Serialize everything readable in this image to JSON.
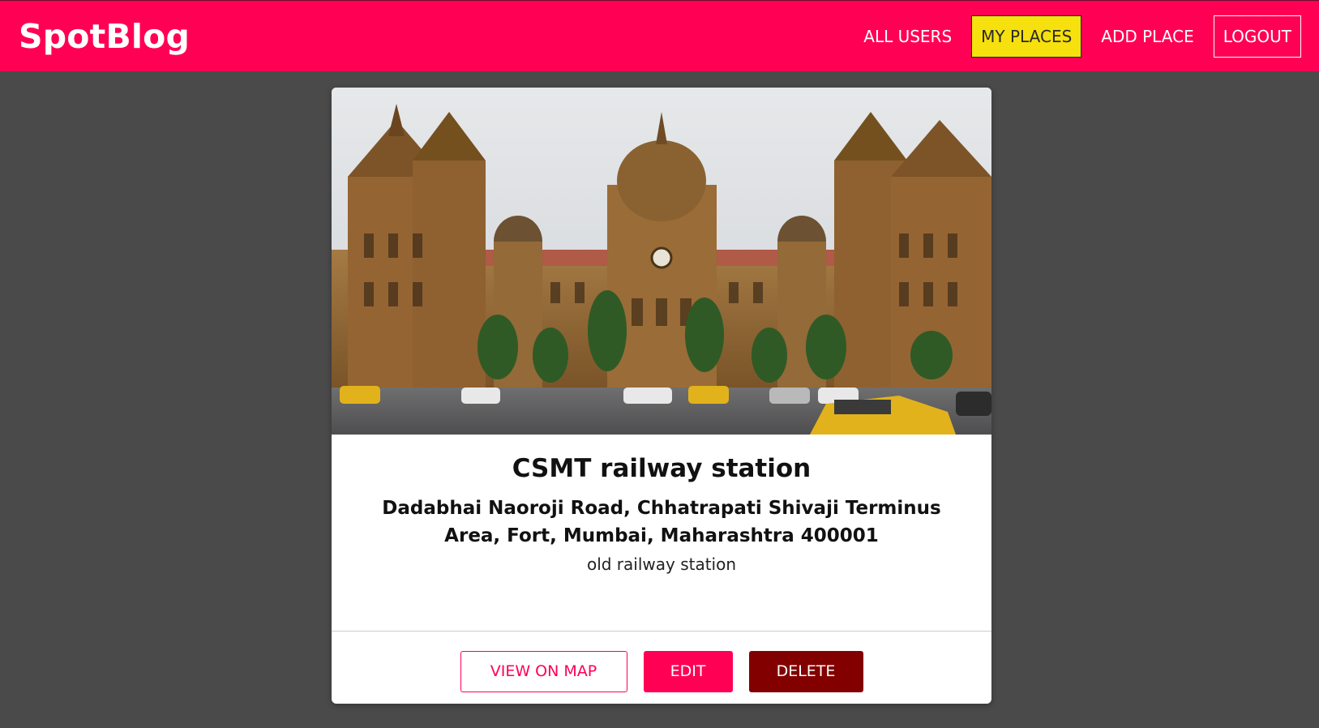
{
  "app": {
    "brand": "SpotBlog"
  },
  "nav": {
    "items": [
      {
        "label": "ALL USERS",
        "active": false
      },
      {
        "label": "MY PLACES",
        "active": true
      },
      {
        "label": "ADD PLACE",
        "active": false
      },
      {
        "label": "LOGOUT",
        "active": false
      }
    ]
  },
  "place": {
    "title": "CSMT railway station",
    "address": "Dadabhai Naoroji Road, Chhatrapati Shivaji Terminus Area, Fort, Mumbai, Maharashtra 400001",
    "description": "old railway station",
    "image_icon": "photo-of-railway-station-building"
  },
  "actions": {
    "view_on_map": "VIEW ON MAP",
    "edit": "EDIT",
    "delete": "DELETE"
  },
  "colors": {
    "brand_pink": "#ff0055",
    "active_yellow": "#f6e00e",
    "delete_dark_red": "#830000",
    "background_gray": "#4a4a4a"
  }
}
